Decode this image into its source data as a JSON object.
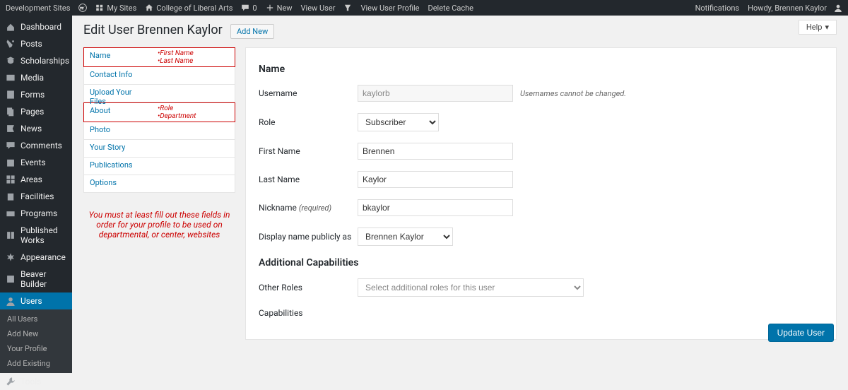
{
  "toolbar": {
    "site_group": "Development Sites",
    "my_sites": "My Sites",
    "site_name": "College of Liberal Arts",
    "comments": "0",
    "new": "New",
    "view_user": "View User",
    "view_profile": "View User Profile",
    "delete_cache": "Delete Cache",
    "notifications": "Notifications",
    "howdy": "Howdy, Brennen Kaylor"
  },
  "sidebar": {
    "items": [
      "Dashboard",
      "Posts",
      "Scholarships",
      "Media",
      "Forms",
      "Pages",
      "News",
      "Comments",
      "Events",
      "Areas",
      "Facilities",
      "Programs",
      "Published Works",
      "Appearance",
      "Beaver Builder",
      "Users",
      "Tools"
    ],
    "subitems": [
      "All Users",
      "Add New",
      "Your Profile",
      "Add Existing"
    ]
  },
  "page": {
    "title": "Edit User Brennen Kaylor",
    "add_new": "Add New",
    "help": "Help"
  },
  "tabs": [
    {
      "label": "Name",
      "req": "•First Name\n•Last Name",
      "hl": true
    },
    {
      "label": "Contact Info",
      "req": "",
      "hl": false
    },
    {
      "label": "Upload Your Files",
      "req": "",
      "hl": false
    },
    {
      "label": "About",
      "req": "•Role\n•Department",
      "hl": true
    },
    {
      "label": "Photo",
      "req": "",
      "hl": false
    },
    {
      "label": "Your Story",
      "req": "",
      "hl": false
    },
    {
      "label": "Publications",
      "req": "",
      "hl": false
    },
    {
      "label": "Options",
      "req": "",
      "hl": false
    }
  ],
  "instruction": "You must at least fill out these fields in order for your profile to be used on departmental, or center, websites",
  "form": {
    "section1": "Name",
    "username_label": "Username",
    "username_value": "kaylorb",
    "username_note": "Usernames cannot be changed.",
    "role_label": "Role",
    "role_value": "Subscriber",
    "firstname_label": "First Name",
    "firstname_value": "Brennen",
    "lastname_label": "Last Name",
    "lastname_value": "Kaylor",
    "nickname_label": "Nickname",
    "nickname_req": "(required)",
    "nickname_value": "bkaylor",
    "display_label": "Display name publicly as",
    "display_value": "Brennen Kaylor",
    "section2": "Additional Capabilities",
    "other_roles_label": "Other Roles",
    "other_roles_placeholder": "Select additional roles for this user",
    "caps_label": "Capabilities"
  },
  "buttons": {
    "update": "Update User"
  }
}
